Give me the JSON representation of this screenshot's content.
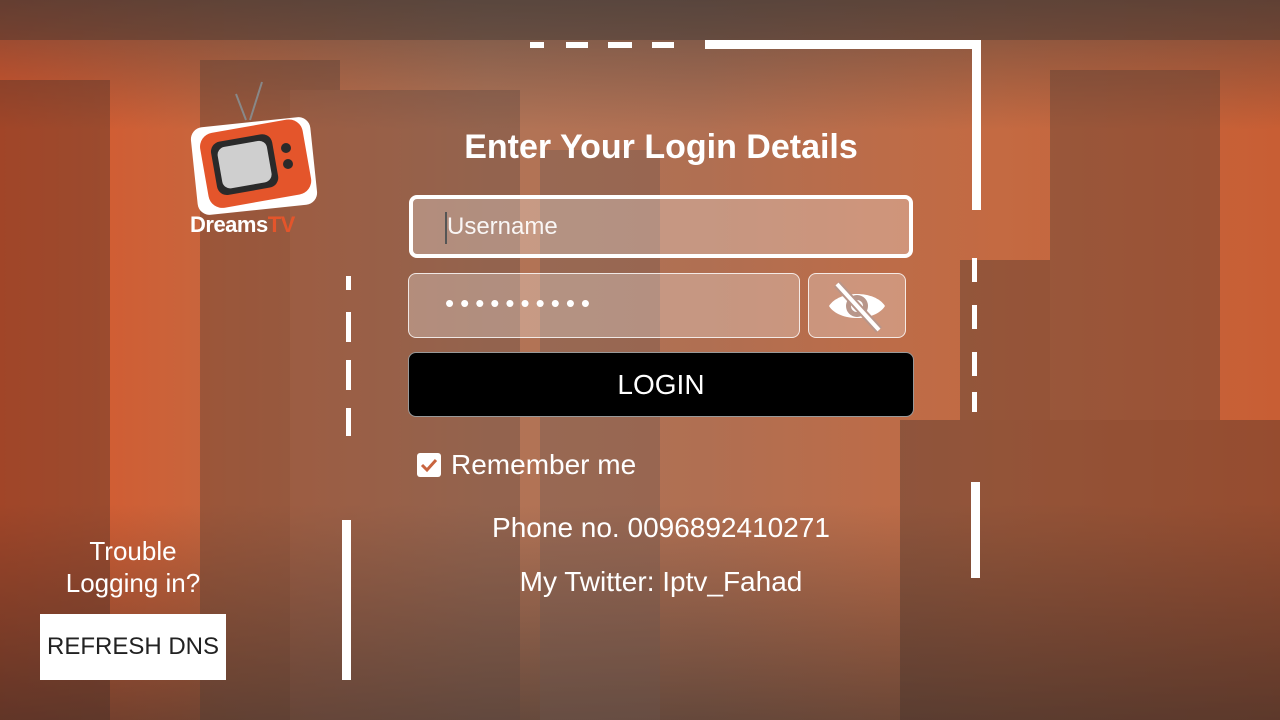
{
  "app": {
    "logo": {
      "word": "Dreams",
      "accent": "TV"
    }
  },
  "login": {
    "title": "Enter Your Login Details",
    "username_placeholder": "Username",
    "password_masked": "••••••••••",
    "toggle_icon": "eye-off-icon",
    "login_label": "LOGIN",
    "remember_label": "Remember me",
    "remember_checked": true
  },
  "contact": {
    "phone": "Phone no. 0096892410271",
    "twitter": "My Twitter: Iptv_Fahad"
  },
  "help": {
    "trouble_line1": "Trouble",
    "trouble_line2": "Logging in?",
    "refresh_label": "REFRESH DNS"
  },
  "colors": {
    "accent": "#e4552b",
    "button": "#000000"
  }
}
